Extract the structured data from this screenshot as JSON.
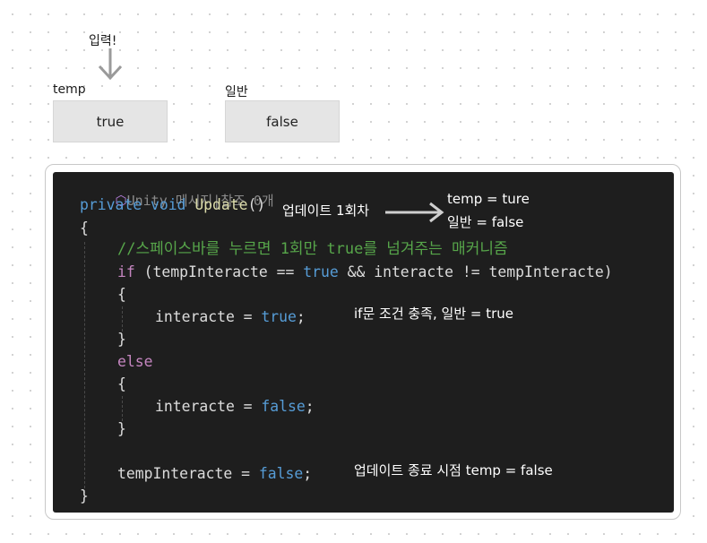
{
  "top": {
    "input_label": "입력!",
    "temp_label": "temp",
    "temp_value": "true",
    "normal_label": "일반",
    "normal_value": "false"
  },
  "code": {
    "codelens_unity": "Unity 메시지",
    "codelens_sep": "|",
    "codelens_refs": "참조 0개",
    "l1_private": "private",
    "l1_void": "void",
    "l1_name": "Update",
    "l1_parens": "()",
    "l2": "{",
    "comment": "//스페이스바를 누르면 1회만 true를 넘겨주는 매커니즘",
    "if_kw": "if",
    "if_a": " (tempInteracte == ",
    "if_true": "true",
    "if_b": " && interacte != tempInteracte)",
    "open1": "{",
    "assign_a": "interacte = ",
    "assign_a_val": "true",
    "semi": ";",
    "close1": "}",
    "else_kw": "else",
    "open2": "{",
    "assign_b": "interacte = ",
    "assign_b_val": "false",
    "close2": "}",
    "assign_c": "tempInteracte = ",
    "assign_c_val": "false",
    "close_main": "}"
  },
  "notes": {
    "update_once": "업데이트 1회차",
    "temp_ture": "temp = ture",
    "normal_false": "일반 = false",
    "if_cond": "if문 조건 충족, 일반 = true",
    "update_end": "업데이트 종료 시점 temp = false"
  },
  "colors": {
    "keyword": "#569cd6",
    "control": "#c586c0",
    "comment": "#57a64a",
    "method": "#dcdcaa",
    "editor_bg": "#1e1e1e"
  }
}
